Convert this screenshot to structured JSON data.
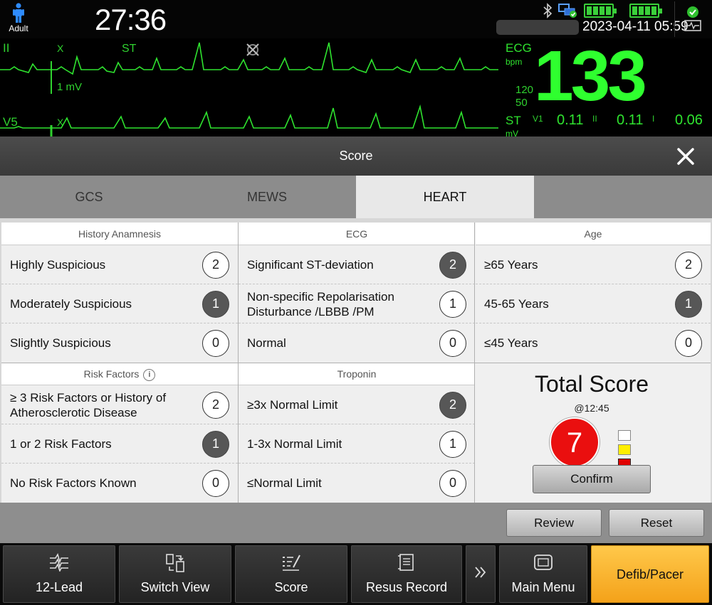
{
  "topbar": {
    "patient_type": "Adult",
    "timer": "27:36",
    "datetime": "2023-04-11 05:59"
  },
  "waveforms": {
    "lead_ii": "II",
    "lead_v5": "V5",
    "st_marker": "ST",
    "x_marker": "X",
    "scale": "1 mV"
  },
  "params": {
    "ecg_label": "ECG",
    "bpm_label": "bpm",
    "hr": "133",
    "hr_high": "120",
    "hr_low": "50",
    "st_label": "ST",
    "st_unit": "mV",
    "st_leads": [
      {
        "lead": "V1",
        "value": "0.11"
      },
      {
        "lead": "II",
        "value": "0.11"
      },
      {
        "lead": "I",
        "value": "0.06"
      }
    ]
  },
  "dialog": {
    "title": "Score",
    "tabs": [
      "GCS",
      "MEWS",
      "HEART"
    ],
    "sections": {
      "history": {
        "title": "History Anamnesis",
        "rows": [
          {
            "label": "Highly Suspicious",
            "score": "2",
            "selected": false
          },
          {
            "label": "Moderately Suspicious",
            "score": "1",
            "selected": true
          },
          {
            "label": "Slightly Suspicious",
            "score": "0",
            "selected": false
          }
        ]
      },
      "ecg": {
        "title": "ECG",
        "rows": [
          {
            "label": "Significant ST-deviation",
            "score": "2",
            "selected": true
          },
          {
            "label": "Non-specific Repolarisation Disturbance /LBBB /PM",
            "score": "1",
            "selected": false
          },
          {
            "label": "Normal",
            "score": "0",
            "selected": false
          }
        ]
      },
      "age": {
        "title": "Age",
        "rows": [
          {
            "label": "≥65 Years",
            "score": "2",
            "selected": false
          },
          {
            "label": "45-65 Years",
            "score": "1",
            "selected": true
          },
          {
            "label": "≤45 Years",
            "score": "0",
            "selected": false
          }
        ]
      },
      "risk": {
        "title": "Risk Factors",
        "rows": [
          {
            "label": "≥ 3 Risk Factors or History of Atherosclerotic Disease",
            "score": "2",
            "selected": false
          },
          {
            "label": "1 or 2 Risk Factors",
            "score": "1",
            "selected": true
          },
          {
            "label": "No Risk Factors Known",
            "score": "0",
            "selected": false
          }
        ]
      },
      "troponin": {
        "title": "Troponin",
        "rows": [
          {
            "label": "≥3x Normal Limit",
            "score": "2",
            "selected": true
          },
          {
            "label": "1-3x Normal Limit",
            "score": "1",
            "selected": false
          },
          {
            "label": "≤Normal Limit",
            "score": "0",
            "selected": false
          }
        ]
      }
    },
    "total": {
      "title": "Total Score",
      "time": "@12:45",
      "value": "7",
      "confirm": "Confirm"
    },
    "footer": {
      "review": "Review",
      "reset": "Reset"
    }
  },
  "funcbar": [
    {
      "label": "12-Lead",
      "icon": "twelve-lead-icon"
    },
    {
      "label": "Switch View",
      "icon": "switch-view-icon"
    },
    {
      "label": "Score",
      "icon": "score-icon"
    },
    {
      "label": "Resus Record",
      "icon": "resus-record-icon"
    },
    {
      "label": "Main Menu",
      "icon": "main-menu-icon"
    },
    {
      "label": "Defib/Pacer",
      "icon": ""
    }
  ],
  "colors": {
    "waveform": "#2fe32f",
    "battery": "#3ad03a",
    "total_score": "#ea0f0f",
    "selected_badge": "#575757",
    "defib_button": "#f4a21a"
  }
}
